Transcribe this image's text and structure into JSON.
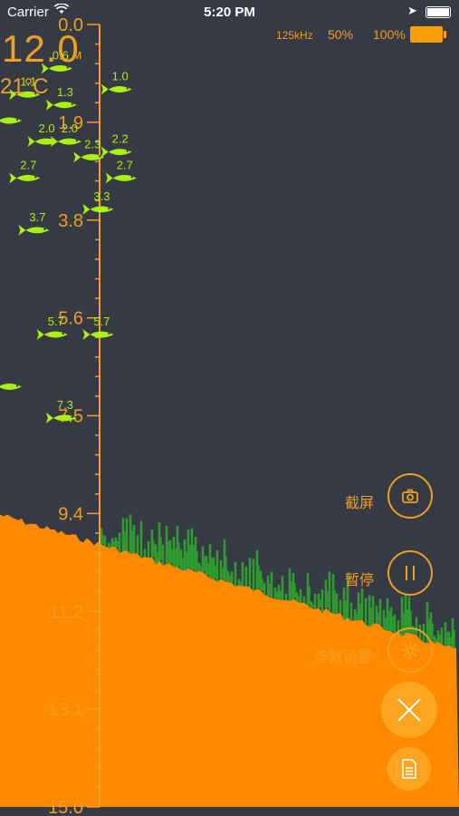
{
  "status_bar": {
    "carrier": "Carrier",
    "time": "5:20 PM"
  },
  "header": {
    "frequency": "125kHz",
    "sensitivity": "50%",
    "battery": "100%"
  },
  "readout": {
    "depth_value": "12.0",
    "depth_unit": "м",
    "temperature": "21°C"
  },
  "depth_scale": {
    "ticks": [
      "0.0",
      "1.9",
      "3.8",
      "5.6",
      "7.5",
      "9.4",
      "11.2",
      "13.1",
      "15.0"
    ],
    "max_depth": 15.0
  },
  "fish": [
    {
      "label": "0.6",
      "depth": 0.6,
      "col": 0.11
    },
    {
      "label": "1.0",
      "depth": 1.0,
      "col": 0.24
    },
    {
      "label": "1.1",
      "depth": 1.1,
      "col": 0.04
    },
    {
      "label": "1.3",
      "depth": 1.3,
      "col": 0.12
    },
    {
      "label": "",
      "depth": 1.6,
      "col": 0.0
    },
    {
      "label": "2.0",
      "depth": 2.0,
      "col": 0.08
    },
    {
      "label": "2.0",
      "depth": 2.0,
      "col": 0.13
    },
    {
      "label": "2.2",
      "depth": 2.2,
      "col": 0.24
    },
    {
      "label": "2.3",
      "depth": 2.3,
      "col": 0.18
    },
    {
      "label": "2.7",
      "depth": 2.7,
      "col": 0.04
    },
    {
      "label": "2.7",
      "depth": 2.7,
      "col": 0.25
    },
    {
      "label": "3.3",
      "depth": 3.3,
      "col": 0.2
    },
    {
      "label": "3.7",
      "depth": 3.7,
      "col": 0.06
    },
    {
      "label": "5.7",
      "depth": 5.7,
      "col": 0.1
    },
    {
      "label": "5.7",
      "depth": 5.7,
      "col": 0.2
    },
    {
      "label": "",
      "depth": 6.7,
      "col": 0.0
    },
    {
      "label": "7.3",
      "depth": 7.3,
      "col": 0.12
    }
  ],
  "bottom_profile": {
    "depth_start": 9.4,
    "depth_end": 12.0
  },
  "actions": {
    "screenshot": "截屏",
    "pause": "暂停",
    "settings": "参数设置"
  },
  "colors": {
    "background": "#363a45",
    "accent": "#f0a020",
    "bottom_fill": "#ff8a00",
    "fish": "#aaf010",
    "weeds": "#2e9e2e"
  }
}
